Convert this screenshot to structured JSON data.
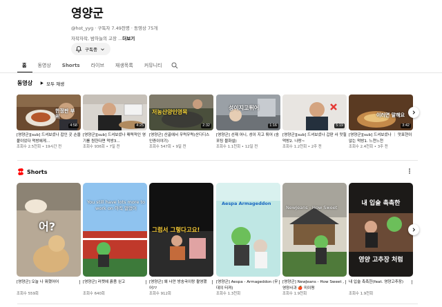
{
  "channel": {
    "name": "영양군",
    "meta": "@hot_yyg · 구독자 7.49천명 · 동영상 75개",
    "description": "자작자작, 밤하늘의 고장 ...",
    "more_label": "더보기",
    "subscribe_label": "구독중"
  },
  "tabs": [
    {
      "label": "홈"
    },
    {
      "label": "동영상"
    },
    {
      "label": "Shorts"
    },
    {
      "label": "라이브"
    },
    {
      "label": "재생목록"
    },
    {
      "label": "커뮤니티"
    }
  ],
  "videos_section": {
    "title": "동영상",
    "play_all_label": "모두 재생",
    "items": [
      {
        "title": "[영양군][sub] 드셔보셨나 잡인 곳 손을 붙이었다 먹방에게...",
        "meta": "조회수 2.5천회 • 19시간 전",
        "duration": "4:58",
        "overlay": "한정판 부위"
      },
      {
        "title": "[영양군][sub] 드셔보셨나 매력적인 영기를 원한다면 먹방3...",
        "meta": "조회수 936회 • 7일 전",
        "duration": "4:25",
        "overlay": ""
      },
      {
        "title": "[영양군] 산골에서 우럭우럭(산디디스 인증이야기)",
        "meta": "조회수 547회 • 9일 전",
        "duration": "2:32",
        "overlay": "저농산양인영목"
      },
      {
        "title": "[영양군] 선재 어니, 성이 지고 튀어 (송포팅 블화설)",
        "meta": "조회수 1.1천회 • 12일 전",
        "duration": "1:16",
        "overlay": "성이지고튀어"
      },
      {
        "title": "[영양군][sub] 드셔보셨나 갑판 사 맛힐 먹방2. 나랑~",
        "meta": "조회수 1.2천회 • 2주 전",
        "duration": "5:19",
        "overlay": ""
      },
      {
        "title": "[영양군][sub] 드셔보셨나 ｜ 맛표현이 없는 먹방1. 느천느천",
        "meta": "조회수 2.4천회 • 3주 전",
        "duration": "3:42",
        "overlay": "이러면 말해요"
      }
    ]
  },
  "shorts_section": {
    "title": "Shorts",
    "items": [
      {
        "title": "[영양군] 오늘 나 뭐했어어",
        "views": "조회수 559회",
        "overlay": "어?"
      },
      {
        "title": "[영양군] 러켓에 흙좀 싣고",
        "views": "조회수 640회",
        "overlay": "You still have lots more to work on 아직 멀었어"
      },
      {
        "title": "[영양군] 왜 너만 방송국이랑 촬영했어??",
        "views": "조회수 912회",
        "overlay": "그럼서 그렇다고요!"
      },
      {
        "title": "[영양군] Aespa - Armageddon (무대의 터져)",
        "views": "조회수 1.3천회",
        "overlay": "Aespa Armageddon"
      },
      {
        "title": "[영양군] NewJeans - How Sweet , 영양사과 🍎 미이평",
        "views": "조회수 1.9천회",
        "overlay": "NewJeans - How Sweet"
      },
      {
        "title": "내 입술 촉촉한(feat. 영양고추장)",
        "views": "조회수 1.9천회",
        "overlay_top": "내 입술 촉촉한",
        "overlay_bottom": "영양 고추장 처럼"
      }
    ]
  },
  "colors": {
    "text_primary": "#0f0f0f",
    "text_secondary": "#606060",
    "shorts_red": "#ff0000",
    "chip_bg": "#f2f2f2"
  },
  "icons": {
    "subscribe": "bell-icon",
    "dropdown": "chevron-down-icon",
    "search": "search-icon",
    "play_all": "play-icon",
    "shorts": "shorts-logo-icon",
    "more": "more-vert-icon",
    "next": "chevron-right-icon"
  }
}
